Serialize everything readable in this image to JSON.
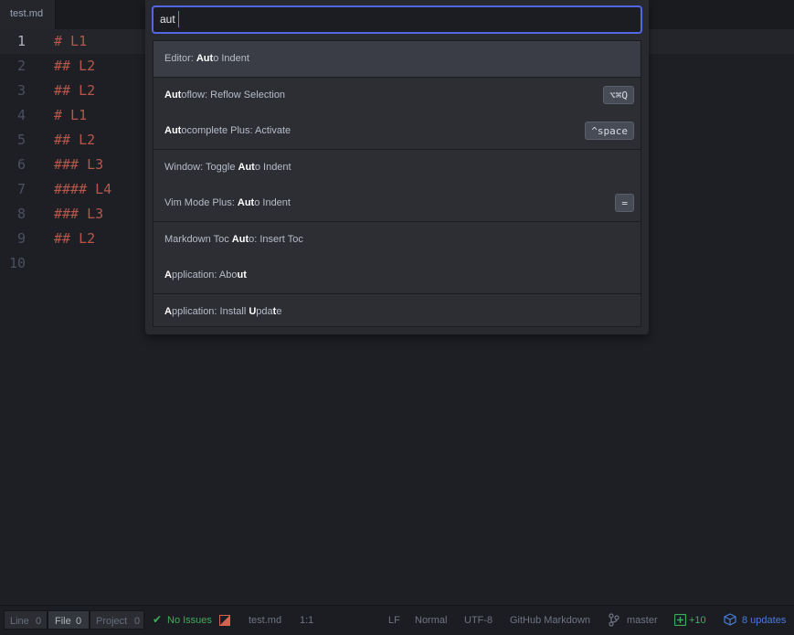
{
  "tab": {
    "title": "test.md"
  },
  "editor": {
    "line_numbers": [
      "1",
      "2",
      "3",
      "4",
      "5",
      "6",
      "7",
      "8",
      "9",
      "10"
    ],
    "lines": [
      "# L1",
      "## L2",
      "## L2",
      "# L1",
      "## L2",
      "### L3",
      "#### L4",
      "### L3",
      "## L2",
      ""
    ]
  },
  "palette": {
    "query": "aut",
    "items": [
      {
        "pre": "Editor: ",
        "b1": "Aut",
        "mid": "o Indent",
        "b2": "",
        "post": "",
        "kbd": ""
      },
      {
        "pre": "",
        "b1": "Aut",
        "mid": "oflow: Reflow Selection",
        "b2": "",
        "post": "",
        "kbd": "⌥⌘Q"
      },
      {
        "pre": "",
        "b1": "Aut",
        "mid": "ocomplete Plus: Activate",
        "b2": "",
        "post": "",
        "kbd": "^space"
      },
      {
        "pre": "Window: Toggle ",
        "b1": "Aut",
        "mid": "o Indent",
        "b2": "",
        "post": "",
        "kbd": ""
      },
      {
        "pre": "Vim Mode Plus: ",
        "b1": "Aut",
        "mid": "o Indent",
        "b2": "",
        "post": "",
        "kbd": "="
      },
      {
        "pre": "Markdown Toc ",
        "b1": "Aut",
        "mid": "o: Insert Toc",
        "b2": "",
        "post": "",
        "kbd": ""
      },
      {
        "pre": "",
        "b1": "A",
        "mid": "pplication: Abo",
        "b2": "ut",
        "post": "",
        "kbd": ""
      },
      {
        "pre": "",
        "b1": "A",
        "mid": "pplication: Install ",
        "b2": "U",
        "post": "pda",
        "b3": "t",
        "post2": "e",
        "kbd": ""
      }
    ]
  },
  "statusbar": {
    "line_label": "Line",
    "line_count": "0",
    "file_label": "File",
    "file_count": "0",
    "project_label": "Project",
    "project_count": "0",
    "issues": "No Issues",
    "filename": "test.md",
    "cursor": "1:1",
    "line_ending": "LF",
    "mode": "Normal",
    "encoding": "UTF-8",
    "grammar": "GitHub Markdown",
    "branch": "master",
    "diff": "+10",
    "updates": "8 updates"
  }
}
